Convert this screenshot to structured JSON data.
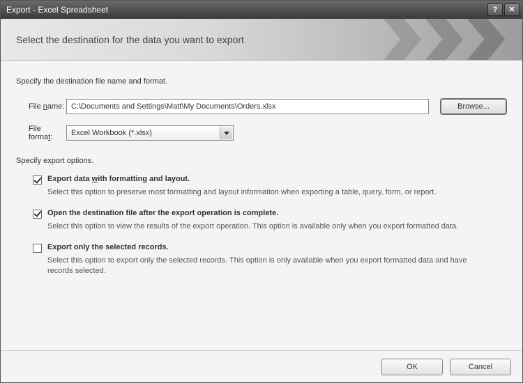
{
  "window": {
    "title": "Export - Excel Spreadsheet"
  },
  "header": {
    "heading": "Select the destination for the data you want to export"
  },
  "dest_section_label": "Specify the destination file name and format.",
  "file": {
    "label_pre": "File ",
    "label_u": "n",
    "label_post": "ame:",
    "value": "C:\\Documents and Settings\\Matt\\My Documents\\Orders.xlsx",
    "browse": "Browse..."
  },
  "format": {
    "label_pre": "File forma",
    "label_u": "t",
    "label_post": ":",
    "selected": "Excel Workbook (*.xlsx)"
  },
  "options_section_label": "Specify export options.",
  "options": {
    "opt1": {
      "checked": true,
      "title_pre": "Export data ",
      "title_u": "w",
      "title_post": "ith formatting and layout.",
      "desc": "Select this option to preserve most formatting and layout information when exporting a table, query, form, or report."
    },
    "opt2": {
      "checked": true,
      "title_pre": "Open the destination file after the export operation is complete.",
      "desc": "Select this option to view the results of the export operation. This option is available only when you export formatted data."
    },
    "opt3": {
      "checked": false,
      "title_pre": "Export only the selected records.",
      "desc": "Select this option to export only the selected records. This option is only available when you export formatted data and have records selected."
    }
  },
  "footer": {
    "ok": "OK",
    "cancel": "Cancel"
  }
}
